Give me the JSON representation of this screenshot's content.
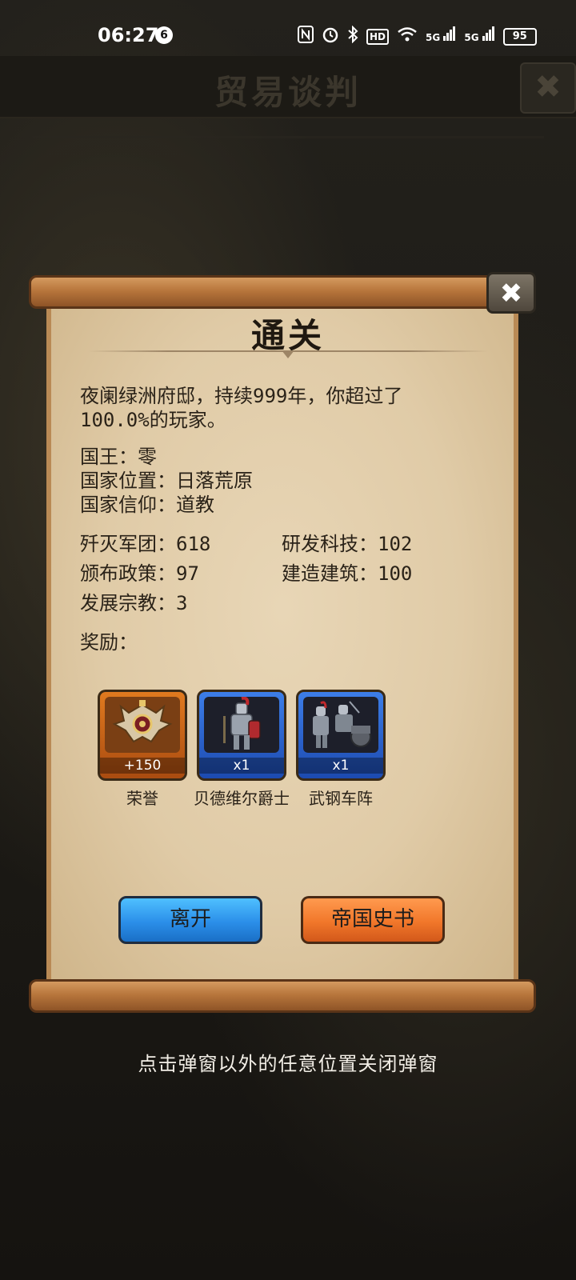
{
  "status_bar": {
    "time": "06:27",
    "notification_count": "6",
    "icons": [
      "nfc-icon",
      "alarm-icon",
      "bluetooth-icon",
      "hd-icon",
      "wifi-icon",
      "signal-5g-icon",
      "signal-5g-icon"
    ],
    "hd_label": "HD",
    "net1": "5G",
    "net2": "5G",
    "battery": "95"
  },
  "background": {
    "title": "贸易谈判",
    "close_symbol": "✖",
    "hint": "点击弹窗以外的任意位置关闭弹窗"
  },
  "dialog": {
    "title": "通关",
    "close_symbol": "✖",
    "summary": "夜阑绿洲府邸，持续999年，你超过了100.0%的玩家。",
    "king": "国王：零",
    "location": "国家位置：日落荒原",
    "religion": "国家信仰：道教",
    "stats": {
      "legions_destroyed": "歼灭军团：618",
      "tech_researched": "研发科技：102",
      "policies_issued": "颁布政策：97",
      "buildings_built": "建造建筑：100",
      "religions_developed": "发展宗教：3"
    },
    "rewards_label": "奖励：",
    "rewards": [
      {
        "name": "荣誉",
        "count": "+150",
        "color": "#e07a1f",
        "icon": "honor-emblem-icon"
      },
      {
        "name": "贝德维尔爵士",
        "count": "x1",
        "color": "#3d7ee8",
        "icon": "knight-icon"
      },
      {
        "name": "武钢车阵",
        "count": "x1",
        "color": "#3d7ee8",
        "icon": "chariot-formation-icon"
      }
    ],
    "buttons": {
      "leave": "离开",
      "history": "帝国史书"
    }
  },
  "colors": {
    "paper": "#e0cba7",
    "scroll_roll": "#b8763c",
    "leave_button": "#2b8fe9",
    "history_button": "#f1772a"
  }
}
